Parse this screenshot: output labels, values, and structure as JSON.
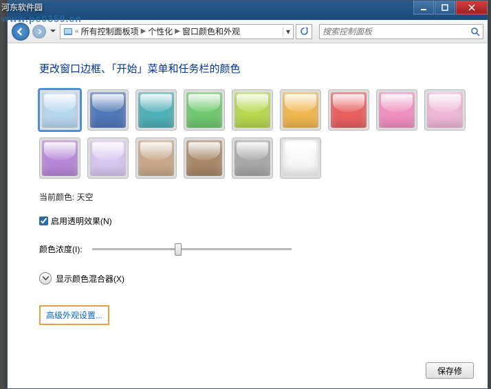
{
  "watermark": {
    "line1": "河东软件园",
    "line2": "www.pc0359.cn"
  },
  "titlebar": {
    "min": "minimize",
    "max": "maximize",
    "close": "close"
  },
  "nav": {
    "crumb1": "所有控制面板项",
    "crumb2": "个性化",
    "crumb3": "窗口颜色和外观",
    "search_placeholder": "搜索控制面板"
  },
  "heading": "更改窗口边框、「开始」菜单和任务栏的颜色",
  "colors": [
    {
      "name": "天空",
      "hex": "#b8d8f0",
      "selected": true
    },
    {
      "name": "蓝",
      "hex": "#5078b8"
    },
    {
      "name": "青",
      "hex": "#50b0b8"
    },
    {
      "name": "绿",
      "hex": "#70c870"
    },
    {
      "name": "黄绿",
      "hex": "#b8d850"
    },
    {
      "name": "橙",
      "hex": "#f0b850"
    },
    {
      "name": "红",
      "hex": "#e86060"
    },
    {
      "name": "粉",
      "hex": "#f090c0"
    },
    {
      "name": "淡粉",
      "hex": "#f0b8d8"
    },
    {
      "name": "紫",
      "hex": "#b888d8"
    },
    {
      "name": "淡紫",
      "hex": "#d8c8f0"
    },
    {
      "name": "棕",
      "hex": "#c8a888"
    },
    {
      "name": "深棕",
      "hex": "#a88868"
    },
    {
      "name": "灰",
      "hex": "#a8a8a8"
    },
    {
      "name": "白",
      "hex": "#f8f8f8"
    }
  ],
  "current_label": "当前颜色: ",
  "current_value": "天空",
  "transparency_label": "启用透明效果(N)",
  "transparency_checked": true,
  "intensity_label": "颜色浓度(I):",
  "mixer_label": "显示颜色混合器(X)",
  "advanced_label": "高级外观设置...",
  "save_btn": "保存修"
}
